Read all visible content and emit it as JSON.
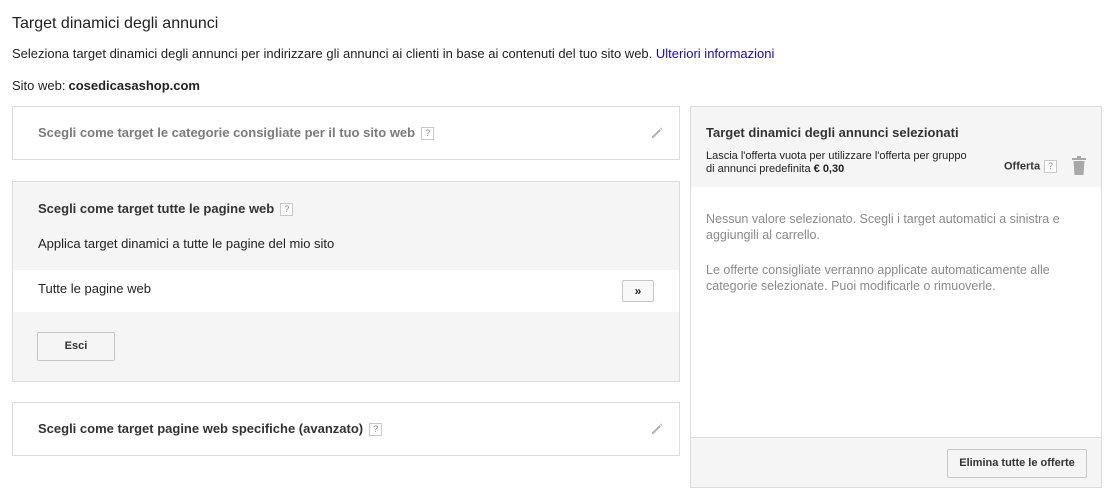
{
  "header": {
    "title": "Target dinamici degli annunci",
    "intro_text": "Seleziona target dinamici degli annunci per indirizzare gli annunci ai clienti in base ai contenuti del tuo sito web.",
    "learn_more_link": "Ulteriori informazioni",
    "site_label": "Sito web:",
    "site_value": "cosedicasashop.com"
  },
  "options": {
    "recommended_categories": {
      "title": "Scegli come target le categorie consigliate per il tuo sito web",
      "help": "?"
    },
    "all_pages": {
      "title": "Scegli come target tutte le pagine web",
      "help": "?",
      "description": "Applica target dinamici a tutte le pagine del mio sito",
      "item_label": "Tutte le pagine web",
      "add_button": "»",
      "exit_button": "Esci"
    },
    "specific_pages": {
      "title": "Scegli come target pagine web specifiche (avanzato)",
      "help": "?"
    }
  },
  "selected_panel": {
    "title": "Target dinamici degli annunci selezionati",
    "description": "Lascia l'offerta vuota per utilizzare l'offerta per gruppo di annunci predefinita",
    "default_bid": "€ 0,30",
    "bid_column": "Offerta",
    "help": "?",
    "empty_message": "Nessun valore selezionato. Scegli i target automatici a sinistra e aggiungili al carrello.",
    "note": "Le offerte consigliate verranno applicate automaticamente alle categorie selezionate. Puoi modificarle o rimuoverle.",
    "clear_button": "Elimina tutte le offerte"
  },
  "icons": {
    "edit": "pencil-icon",
    "delete": "trash-icon",
    "help": "help-icon"
  },
  "colors": {
    "link": "#1a0dab",
    "panel_bg": "#f5f5f5",
    "border": "#dcdcdc",
    "muted_text": "#8a8a8a"
  }
}
